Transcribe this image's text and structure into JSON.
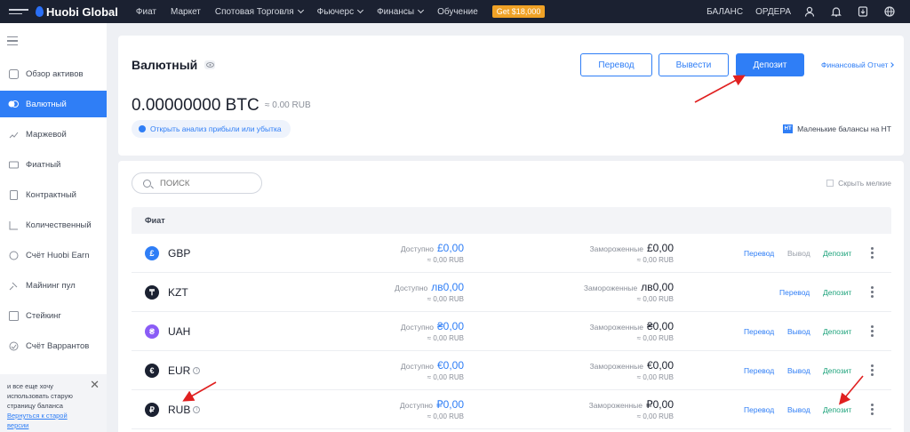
{
  "topbar": {
    "logo": "Huobi Global",
    "nav": [
      {
        "label": "Фиат",
        "dropdown": false
      },
      {
        "label": "Маркет",
        "dropdown": false
      },
      {
        "label": "Спотовая Торговля",
        "dropdown": true
      },
      {
        "label": "Фьючерс",
        "dropdown": true
      },
      {
        "label": "Финансы",
        "dropdown": true
      },
      {
        "label": "Обучение",
        "dropdown": false
      }
    ],
    "promo": "Get $18,000",
    "balance_link": "БАЛАНС",
    "orders_link": "ОРДЕРА"
  },
  "sidebar": {
    "items": [
      {
        "label": "Обзор активов",
        "icon": "overview-icon",
        "active": false
      },
      {
        "label": "Валютный",
        "icon": "currency-icon",
        "active": true
      },
      {
        "label": "Маржевой",
        "icon": "margin-icon",
        "active": false
      },
      {
        "label": "Фиатный",
        "icon": "fiat-icon",
        "active": false
      },
      {
        "label": "Контрактный",
        "icon": "contract-icon",
        "active": false
      },
      {
        "label": "Количественный",
        "icon": "quant-icon",
        "active": false
      },
      {
        "label": "Счёт Huobi Earn",
        "icon": "earn-icon",
        "active": false
      },
      {
        "label": "Майнинг пул",
        "icon": "mining-icon",
        "active": false
      },
      {
        "label": "Стейкинг",
        "icon": "staking-icon",
        "active": false
      },
      {
        "label": "Счёт Варрантов",
        "icon": "warrant-icon",
        "active": false
      }
    ],
    "note": {
      "text": "и все еще хочу использовать старую страницу баланса",
      "link": "Вернуться к старой версии"
    }
  },
  "header": {
    "title": "Валютный",
    "transfer_btn": "Перевод",
    "withdraw_btn": "Вывести",
    "deposit_btn": "Депозит",
    "fin_report": "Финансовый Отчет",
    "balance": "0.00000000 BTC",
    "balance_fiat": "≈ 0.00 RUB",
    "pnl_link": "Открыть анализ прибыли или убытка",
    "small_balances": "Маленькие балансы на HT",
    "ht_badge": "HT"
  },
  "main": {
    "search_placeholder": "ПОИСК",
    "hide_small": "Скрыть мелкие",
    "section_title": "Фиат",
    "available_label": "Доступно",
    "frozen_label": "Замороженные",
    "actions": {
      "transfer": "Перевод",
      "withdraw": "Вывод",
      "deposit": "Депозит"
    },
    "rows": [
      {
        "code": "GBP",
        "symbol": "£",
        "color": "#2f7ef6",
        "available": "£0,00",
        "available_fiat": "≈ 0,00 RUB",
        "frozen": "£0,00",
        "frozen_fiat": "≈ 0,00 RUB",
        "withdraw_enabled": false,
        "has_info": false
      },
      {
        "code": "KZT",
        "symbol": "₸",
        "color": "#1b2131",
        "available": "лв0,00",
        "available_fiat": "≈ 0,00 RUB",
        "frozen": "лв0,00",
        "frozen_fiat": "≈ 0,00 RUB",
        "withdraw_enabled": null,
        "has_info": false
      },
      {
        "code": "UAH",
        "symbol": "₴",
        "color": "#8a5cf6",
        "available": "₴0,00",
        "available_fiat": "≈ 0,00 RUB",
        "frozen": "₴0,00",
        "frozen_fiat": "≈ 0,00 RUB",
        "withdraw_enabled": true,
        "has_info": false
      },
      {
        "code": "EUR",
        "symbol": "€",
        "color": "#1b2131",
        "available": "€0,00",
        "available_fiat": "≈ 0,00 RUB",
        "frozen": "€0,00",
        "frozen_fiat": "≈ 0,00 RUB",
        "withdraw_enabled": true,
        "has_info": true
      },
      {
        "code": "RUB",
        "symbol": "₽",
        "color": "#1b2131",
        "available": "₽0,00",
        "available_fiat": "≈ 0,00 RUB",
        "frozen": "₽0,00",
        "frozen_fiat": "≈ 0,00 RUB",
        "withdraw_enabled": true,
        "has_info": true
      }
    ]
  },
  "colors": {
    "accent": "#2f7ef6",
    "topbar": "#1b2131",
    "deposit_green": "#1ba27a",
    "promo": "#f0a226",
    "annotation_red": "#e02020"
  }
}
